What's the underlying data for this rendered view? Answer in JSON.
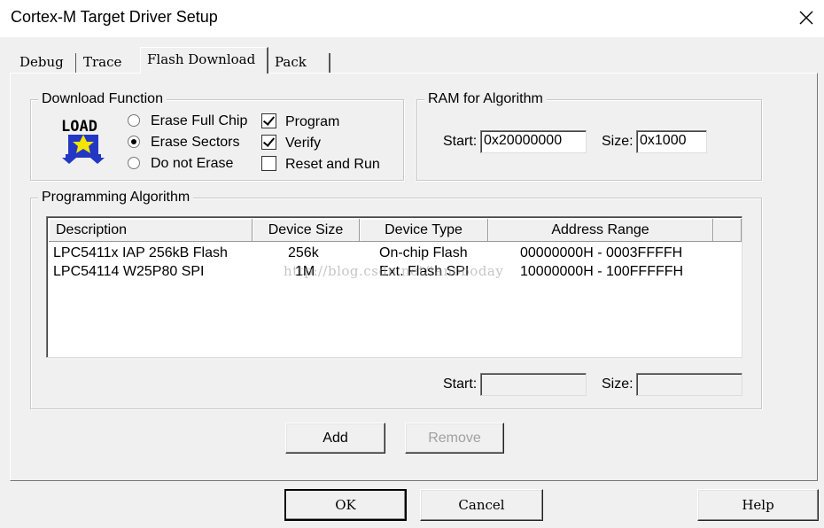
{
  "window": {
    "title": "Cortex-M Target Driver Setup"
  },
  "tabs": [
    {
      "label": "Debug"
    },
    {
      "label": "Trace"
    },
    {
      "label": "Flash Download"
    },
    {
      "label": "Pack"
    }
  ],
  "download_function": {
    "legend": "Download Function",
    "icon_text": "LOAD",
    "radios": [
      {
        "label": "Erase Full Chip",
        "selected": false
      },
      {
        "label": "Erase Sectors",
        "selected": true
      },
      {
        "label": "Do not Erase",
        "selected": false
      }
    ],
    "checkboxes": [
      {
        "label": "Program",
        "checked": true
      },
      {
        "label": "Verify",
        "checked": true
      },
      {
        "label": "Reset and Run",
        "checked": false
      }
    ]
  },
  "ram_for_algorithm": {
    "legend": "RAM for Algorithm",
    "start_label": "Start:",
    "start_value": "0x20000000",
    "size_label": "Size:",
    "size_value": "0x1000"
  },
  "programming_algorithm": {
    "legend": "Programming Algorithm",
    "columns": [
      "Description",
      "Device Size",
      "Device Type",
      "Address Range"
    ],
    "rows": [
      {
        "description": "LPC5411x IAP 256kB Flash",
        "device_size": "256k",
        "device_type": "On-chip Flash",
        "address_range": "00000000H - 0003FFFFH"
      },
      {
        "description": "LPC54114 W25P80 SPI",
        "device_size": "1M",
        "device_type": "Ext. Flash SPI",
        "address_range": "10000000H - 100FFFFFH"
      }
    ],
    "start_label": "Start:",
    "start_value": "",
    "size_label": "Size:",
    "size_value": "",
    "add_label": "Add",
    "remove_label": "Remove"
  },
  "watermark": "http://blog.csdn.net/tanoboday",
  "footer": {
    "ok_label": "OK",
    "cancel_label": "Cancel",
    "help_label": "Help"
  }
}
